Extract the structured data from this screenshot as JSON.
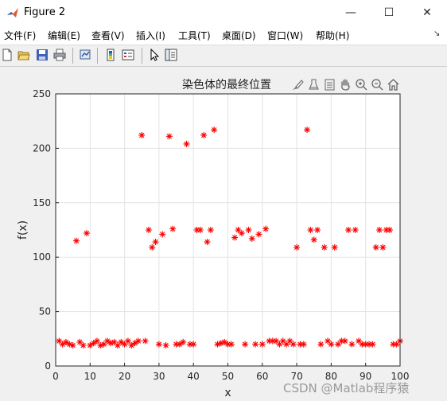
{
  "window": {
    "title": "Figure 2",
    "minimize": "—",
    "maximize": "☐",
    "close": "✕"
  },
  "menu": {
    "items": [
      "文件(F)",
      "编辑(E)",
      "查看(V)",
      "插入(I)",
      "工具(T)",
      "桌面(D)",
      "窗口(W)",
      "帮助(H)"
    ],
    "overflow": "↘"
  },
  "toolbar": {
    "icons": [
      "new-figure-icon",
      "open-file-icon",
      "save-icon",
      "print-icon",
      "link-plot-icon",
      "insert-colorbar-icon",
      "insert-legend-icon",
      "edit-plot-arrow-icon",
      "property-inspector-icon"
    ]
  },
  "axes_toolbar": {
    "icons": [
      "brush-icon",
      "data-tips-icon",
      "rotate-icon",
      "pan-hand-icon",
      "zoom-in-icon",
      "zoom-out-icon",
      "home-icon"
    ]
  },
  "watermark": "CSDN @Matlab程序猿",
  "chart_data": {
    "type": "scatter",
    "title": "染色体的最终位置",
    "xlabel": "x",
    "ylabel": "f(x)",
    "xlim": [
      0,
      100
    ],
    "ylim": [
      0,
      250
    ],
    "xticks": [
      0,
      10,
      20,
      30,
      40,
      50,
      60,
      70,
      80,
      90,
      100
    ],
    "yticks": [
      0,
      50,
      100,
      150,
      200,
      250
    ],
    "grid": true,
    "marker": "*",
    "color": "#ff0000",
    "points": [
      [
        1,
        23
      ],
      [
        2,
        20
      ],
      [
        3,
        22
      ],
      [
        4,
        20
      ],
      [
        5,
        19
      ],
      [
        6,
        115
      ],
      [
        7,
        22
      ],
      [
        8,
        19
      ],
      [
        9,
        122
      ],
      [
        10,
        19
      ],
      [
        11,
        21
      ],
      [
        12,
        23
      ],
      [
        13,
        19
      ],
      [
        14,
        20
      ],
      [
        15,
        23
      ],
      [
        16,
        21
      ],
      [
        17,
        22
      ],
      [
        18,
        19
      ],
      [
        19,
        22
      ],
      [
        20,
        20
      ],
      [
        21,
        23
      ],
      [
        22,
        19
      ],
      [
        23,
        21
      ],
      [
        24,
        23
      ],
      [
        25,
        212
      ],
      [
        26,
        23
      ],
      [
        27,
        125
      ],
      [
        28,
        109
      ],
      [
        29,
        114
      ],
      [
        30,
        20
      ],
      [
        31,
        121
      ],
      [
        32,
        19
      ],
      [
        33,
        211
      ],
      [
        34,
        126
      ],
      [
        35,
        20
      ],
      [
        36,
        20
      ],
      [
        37,
        22
      ],
      [
        38,
        204
      ],
      [
        39,
        20
      ],
      [
        40,
        20
      ],
      [
        41,
        125
      ],
      [
        42,
        125
      ],
      [
        43,
        212
      ],
      [
        44,
        114
      ],
      [
        45,
        125
      ],
      [
        46,
        217
      ],
      [
        47,
        20
      ],
      [
        48,
        21
      ],
      [
        49,
        22
      ],
      [
        50,
        20
      ],
      [
        51,
        20
      ],
      [
        52,
        118
      ],
      [
        53,
        125
      ],
      [
        54,
        122
      ],
      [
        55,
        20
      ],
      [
        56,
        125
      ],
      [
        57,
        117
      ],
      [
        58,
        20
      ],
      [
        59,
        121
      ],
      [
        60,
        20
      ],
      [
        61,
        126
      ],
      [
        62,
        23
      ],
      [
        63,
        23
      ],
      [
        64,
        23
      ],
      [
        65,
        20
      ],
      [
        66,
        23
      ],
      [
        67,
        20
      ],
      [
        68,
        23
      ],
      [
        69,
        20
      ],
      [
        70,
        109
      ],
      [
        71,
        20
      ],
      [
        72,
        20
      ],
      [
        73,
        217
      ],
      [
        74,
        125
      ],
      [
        75,
        116
      ],
      [
        76,
        125
      ],
      [
        77,
        20
      ],
      [
        78,
        109
      ],
      [
        79,
        23
      ],
      [
        80,
        20
      ],
      [
        81,
        109
      ],
      [
        82,
        20
      ],
      [
        83,
        23
      ],
      [
        84,
        23
      ],
      [
        85,
        125
      ],
      [
        86,
        20
      ],
      [
        87,
        125
      ],
      [
        88,
        23
      ],
      [
        89,
        20
      ],
      [
        90,
        20
      ],
      [
        91,
        20
      ],
      [
        92,
        20
      ],
      [
        93,
        109
      ],
      [
        94,
        125
      ],
      [
        95,
        109
      ],
      [
        96,
        125
      ],
      [
        97,
        125
      ],
      [
        98,
        20
      ],
      [
        99,
        20
      ],
      [
        100,
        23
      ]
    ]
  }
}
